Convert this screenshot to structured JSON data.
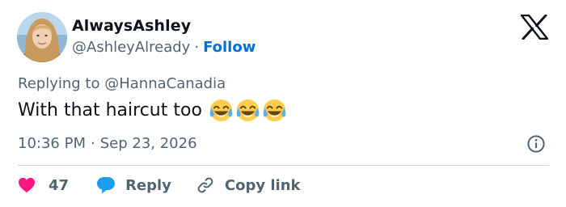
{
  "author": {
    "display_name": "AlwaysAshley",
    "handle": "@AshleyAlready",
    "separator": "·",
    "follow_label": "Follow",
    "avatar_icon": "profile-photo"
  },
  "platform": {
    "logo_icon": "x-logo-icon"
  },
  "tweet": {
    "reply_prefix": "Replying to",
    "reply_to": "@HannaCanadia",
    "text": "With that haircut too",
    "emoji_icon": "face-with-tears-of-joy",
    "emoji_count": 3,
    "time": "10:36 PM",
    "date": "Sep 23, 2026",
    "separator": "·"
  },
  "actions": {
    "like_count": "47",
    "reply_label": "Reply",
    "copy_link_label": "Copy link"
  },
  "colors": {
    "text": "#0f1419",
    "secondary_text": "#536471",
    "follow_blue": "#006fd6",
    "like_red": "#f91880",
    "reply_blue": "#1d9bf0",
    "divider": "#cfd9de"
  }
}
